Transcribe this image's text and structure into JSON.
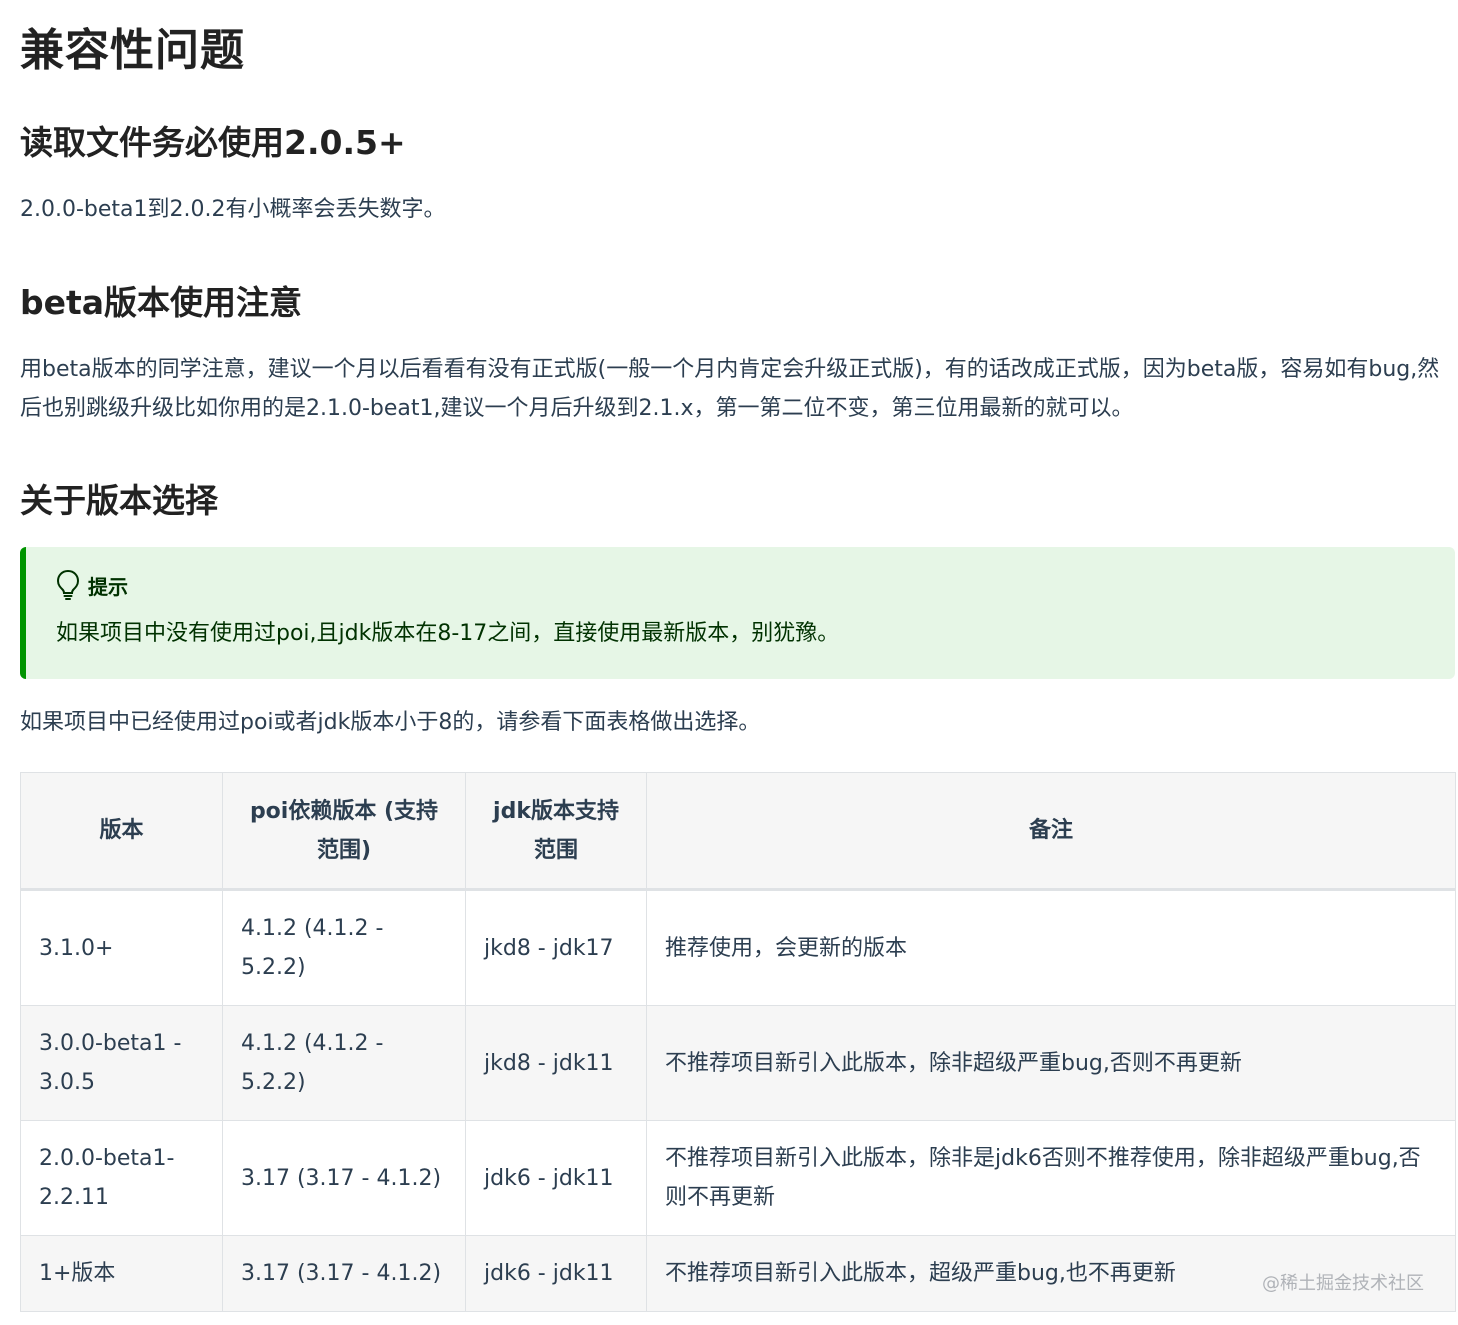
{
  "title": "兼容性问题",
  "sections": {
    "read": {
      "heading": "读取文件务必使用2.0.5+",
      "text": "2.0.0-beta1到2.0.2有小概率会丢失数字。"
    },
    "beta": {
      "heading": "beta版本使用注意",
      "text": "用beta版本的同学注意，建议一个月以后看看有没有正式版(一般一个月内肯定会升级正式版)，有的话改成正式版，因为beta版，容易如有bug,然后也别跳级升级比如你用的是2.1.0-beat1,建议一个月后升级到2.1.x，第一第二位不变，第三位用最新的就可以。"
    },
    "version": {
      "heading": "关于版本选择",
      "tip": {
        "icon": "lightbulb-icon",
        "title": "提示",
        "body": "如果项目中没有使用过poi,且jdk版本在8-17之间，直接使用最新版本，别犹豫。"
      },
      "table_intro": "如果项目中已经使用过poi或者jdk版本小于8的，请参看下面表格做出选择。"
    }
  },
  "table": {
    "headers": [
      "版本",
      "poi依赖版本 (支持范围)",
      "jdk版本支持范围",
      "备注"
    ],
    "rows": [
      [
        "3.1.0+",
        "4.1.2 (4.1.2 - 5.2.2)",
        "jkd8 - jdk17",
        "推荐使用，会更新的版本"
      ],
      [
        "3.0.0-beta1 - 3.0.5",
        "4.1.2 (4.1.2 - 5.2.2)",
        "jkd8 - jdk11",
        "不推荐项目新引入此版本，除非超级严重bug,否则不再更新"
      ],
      [
        "2.0.0-beta1-2.2.11",
        "3.17 (3.17 - 4.1.2)",
        "jdk6 - jdk11",
        "不推荐项目新引入此版本，除非是jdk6否则不推荐使用，除非超级严重bug,否则不再更新"
      ],
      [
        "1+版本",
        "3.17 (3.17 - 4.1.2)",
        "jdk6 - jdk11",
        "不推荐项目新引入此版本，超级严重bug,也不再更新"
      ]
    ]
  },
  "watermark": "@稀土掘金技术社区",
  "colors": {
    "tip_border": "#009400",
    "tip_background": "#e6f6e6",
    "tip_text": "#003100",
    "table_border": "#dfe2e5",
    "table_header_bg": "#f6f6f6"
  }
}
